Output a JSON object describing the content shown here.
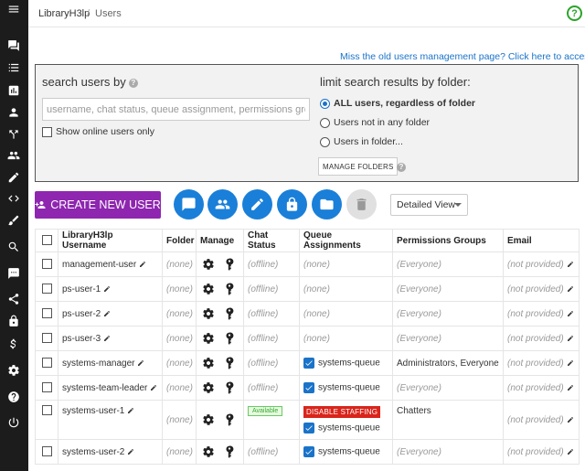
{
  "breadcrumb": {
    "root": "LibraryH3lp",
    "sep": "/",
    "current": "Users"
  },
  "help_icon": "?",
  "old_page_link": "Miss the old users management page? Click here to access it.",
  "search": {
    "title": "search users by",
    "placeholder": "username, chat status, queue assignment, permissions groups",
    "online_only_label": "Show online users only"
  },
  "limit": {
    "title": "limit search results by folder:",
    "options": [
      "ALL users, regardless of folder",
      "Users not in any folder",
      "Users in folder..."
    ],
    "manage_folders_label": "MANAGE FOLDERS"
  },
  "toolbar": {
    "create_user_label": "CREATE NEW USER",
    "view_select_value": "Detailed View",
    "buttons": [
      "chat-icon",
      "group-icon",
      "pencil-icon",
      "lock-icon",
      "folder-icon",
      "trash-icon"
    ]
  },
  "table": {
    "headers": [
      "LibraryH3lp Username",
      "Folder",
      "Manage",
      "Chat Status",
      "Queue Assignments",
      "Permissions Groups",
      "Email"
    ],
    "rows": [
      {
        "username": "management-user",
        "folder": "(none)",
        "chat": "(offline)",
        "queue": "(none)",
        "perms": "(Everyone)",
        "email": "(not provided)"
      },
      {
        "username": "ps-user-1",
        "folder": "(none)",
        "chat": "(offline)",
        "queue": "(none)",
        "perms": "(Everyone)",
        "email": "(not provided)"
      },
      {
        "username": "ps-user-2",
        "folder": "(none)",
        "chat": "(offline)",
        "queue": "(none)",
        "perms": "(Everyone)",
        "email": "(not provided)"
      },
      {
        "username": "ps-user-3",
        "folder": "(none)",
        "chat": "(offline)",
        "queue": "(none)",
        "perms": "(Everyone)",
        "email": "(not provided)"
      },
      {
        "username": "systems-manager",
        "folder": "(none)",
        "chat": "(offline)",
        "queue": "systems-queue",
        "perms": "Administrators, Everyone",
        "email": "(not provided)"
      },
      {
        "username": "systems-team-leader",
        "folder": "(none)",
        "chat": "(offline)",
        "queue": "systems-queue",
        "perms": "(Everyone)",
        "email": "(not provided)"
      },
      {
        "username": "systems-user-1",
        "folder": "(none)",
        "chat": "Available",
        "staffing": "DISABLE STAFFING",
        "queue": "systems-queue",
        "perms": "Chatters",
        "email": "(not provided)"
      },
      {
        "username": "systems-user-2",
        "folder": "(none)",
        "chat": "(offline)",
        "queue": "systems-queue",
        "perms": "(Everyone)",
        "email": "(not provided)"
      }
    ]
  },
  "colors": {
    "accent": "#1a7fd8",
    "create": "#8e26b0",
    "danger": "#d9251b",
    "sidebar": "#1c1c1c"
  }
}
